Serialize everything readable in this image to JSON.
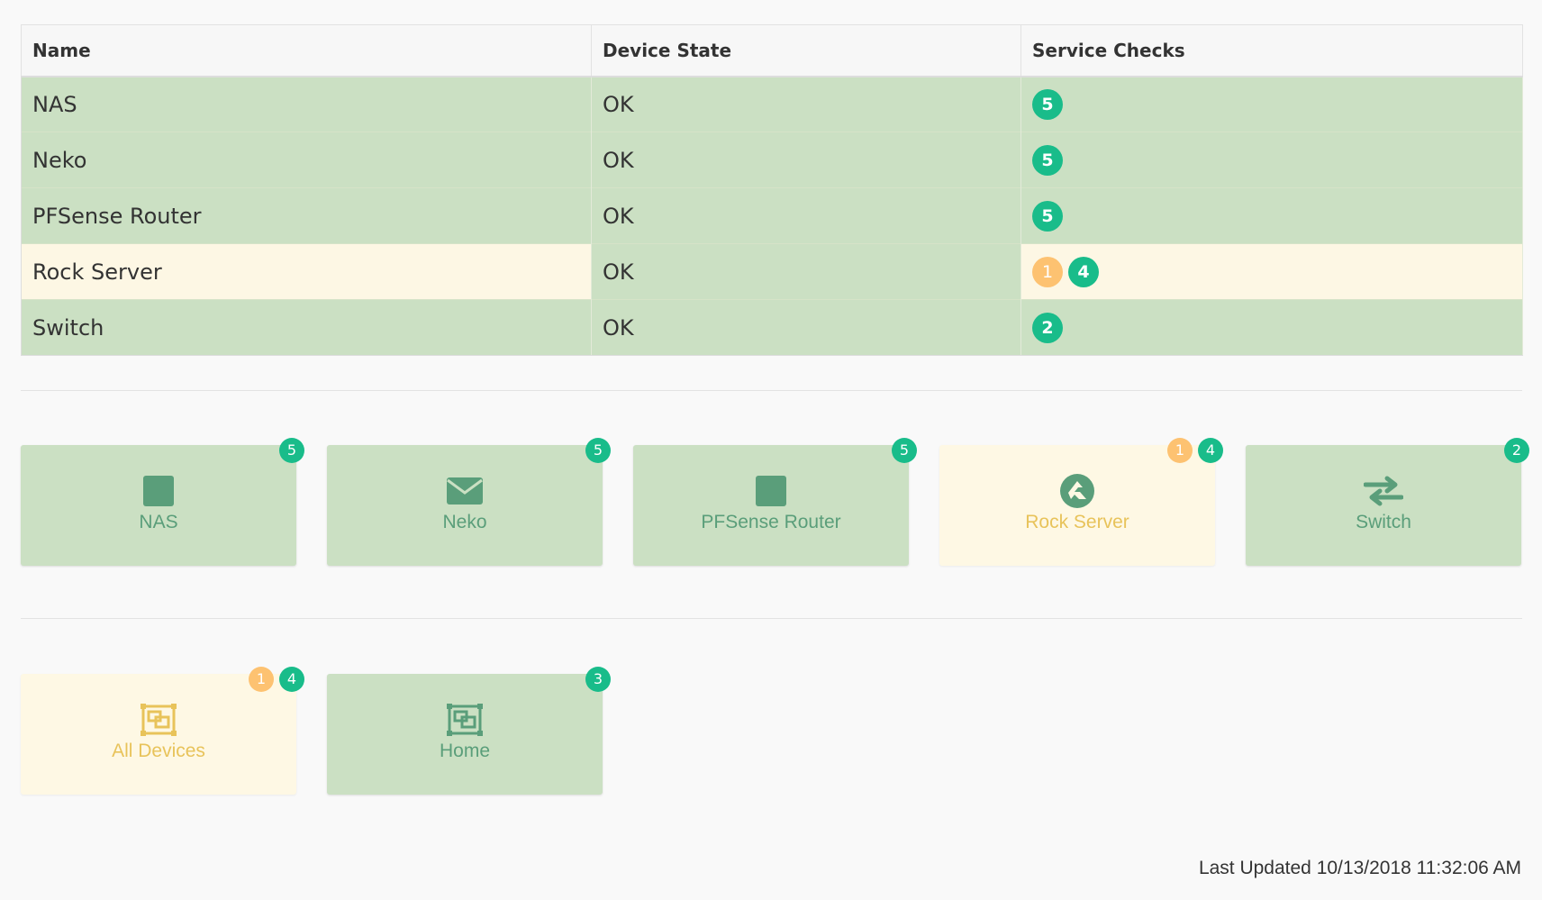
{
  "colors": {
    "ok_row": "#cbe0c3",
    "warn_row": "#fdf7e4",
    "ok_badge": "#19bc8a",
    "warn_badge": "#fdc271",
    "ok_tile_text": "#5a9e7a",
    "warn_tile_text": "#e8c35a"
  },
  "table": {
    "headers": {
      "name": "Name",
      "state": "Device State",
      "checks": "Service Checks"
    },
    "rows": [
      {
        "name": "NAS",
        "state": "OK",
        "status": "ok",
        "checks": [
          {
            "count": "5",
            "kind": "ok"
          }
        ]
      },
      {
        "name": "Neko",
        "state": "OK",
        "status": "ok",
        "checks": [
          {
            "count": "5",
            "kind": "ok"
          }
        ]
      },
      {
        "name": "PFSense Router",
        "state": "OK",
        "status": "ok",
        "checks": [
          {
            "count": "5",
            "kind": "ok"
          }
        ]
      },
      {
        "name": "Rock Server",
        "state": "OK",
        "status": "warn",
        "checks": [
          {
            "count": "1",
            "kind": "warn"
          },
          {
            "count": "4",
            "kind": "ok"
          }
        ]
      },
      {
        "name": "Switch",
        "state": "OK",
        "status": "ok",
        "checks": [
          {
            "count": "2",
            "kind": "ok"
          }
        ]
      }
    ]
  },
  "devices": [
    {
      "label": "NAS",
      "icon": "square-icon",
      "status": "ok",
      "badges": [
        {
          "count": "5",
          "kind": "ok"
        }
      ]
    },
    {
      "label": "Neko",
      "icon": "envelope-icon",
      "status": "ok",
      "badges": [
        {
          "count": "5",
          "kind": "ok"
        }
      ]
    },
    {
      "label": "PFSense Router",
      "icon": "square-icon",
      "status": "ok",
      "badges": [
        {
          "count": "5",
          "kind": "ok"
        }
      ]
    },
    {
      "label": "Rock Server",
      "icon": "rancher-logo-icon",
      "status": "warn",
      "badges": [
        {
          "count": "1",
          "kind": "warn"
        },
        {
          "count": "4",
          "kind": "ok"
        }
      ]
    },
    {
      "label": "Switch",
      "icon": "exchange-arrows-icon",
      "status": "ok",
      "badges": [
        {
          "count": "2",
          "kind": "ok"
        }
      ]
    }
  ],
  "groups": [
    {
      "label": "All Devices",
      "icon": "object-group-icon",
      "status": "warn",
      "badges": [
        {
          "count": "1",
          "kind": "warn"
        },
        {
          "count": "4",
          "kind": "ok"
        }
      ]
    },
    {
      "label": "Home",
      "icon": "object-group-icon",
      "status": "ok",
      "badges": [
        {
          "count": "3",
          "kind": "ok"
        }
      ]
    }
  ],
  "footer": {
    "last_updated": "Last Updated 10/13/2018 11:32:06 AM"
  }
}
